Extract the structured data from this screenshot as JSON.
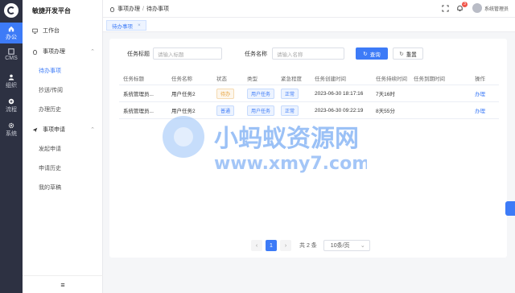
{
  "rail": {
    "items": [
      {
        "label": "办公",
        "icon": "home-icon"
      },
      {
        "label": "CMS",
        "icon": "cms-icon"
      },
      {
        "label": "组织",
        "icon": "user-icon"
      },
      {
        "label": "流程",
        "icon": "plus-circle-icon"
      },
      {
        "label": "系统",
        "icon": "gear-icon"
      }
    ]
  },
  "sidebar": {
    "title": "敏捷开发平台",
    "items": [
      {
        "label": "工作台"
      },
      {
        "label": "事项办理"
      },
      {
        "label": "待办事项"
      },
      {
        "label": "抄送/传阅"
      },
      {
        "label": "办理历史"
      },
      {
        "label": "事项申请"
      },
      {
        "label": "发起申请"
      },
      {
        "label": "申请历史"
      },
      {
        "label": "我的草稿"
      }
    ],
    "footer": "≡"
  },
  "header": {
    "breadcrumb": [
      "事项办理",
      "待办事项"
    ],
    "notification_count": "3",
    "user": "系统管理员"
  },
  "tabs": [
    {
      "label": "待办事项"
    }
  ],
  "filters": {
    "task_title_label": "任务标题",
    "task_title_placeholder": "请输入标题",
    "task_name_label": "任务名称",
    "task_name_placeholder": "请输入名称",
    "search_label": "查询",
    "reset_label": "重置"
  },
  "table": {
    "columns": [
      "任务标题",
      "任务名称",
      "状态",
      "类型",
      "紧急程度",
      "任务创建时间",
      "任务持续时间",
      "任务到期时间",
      "操作"
    ],
    "rows": [
      {
        "title": "系统管理员...",
        "name": "用户任务2",
        "status": "待办",
        "type": "用户任务",
        "urgency": "正常",
        "created": "2023-06-30 18:17:16",
        "duration": "7天16时",
        "due": "",
        "action": "办理"
      },
      {
        "title": "系统管理员...",
        "name": "用户任务2",
        "status": "普通",
        "type": "用户任务",
        "urgency": "正常",
        "created": "2023-06-30 09:22:19",
        "duration": "8天55分",
        "due": "",
        "action": "办理"
      }
    ]
  },
  "pagination": {
    "prev": "‹",
    "current": "1",
    "next": "›",
    "total": "共 2 条",
    "page_size": "10条/页"
  },
  "watermark": {
    "text": "小蚂蚁资源网",
    "url": "www.xmy7.com"
  }
}
